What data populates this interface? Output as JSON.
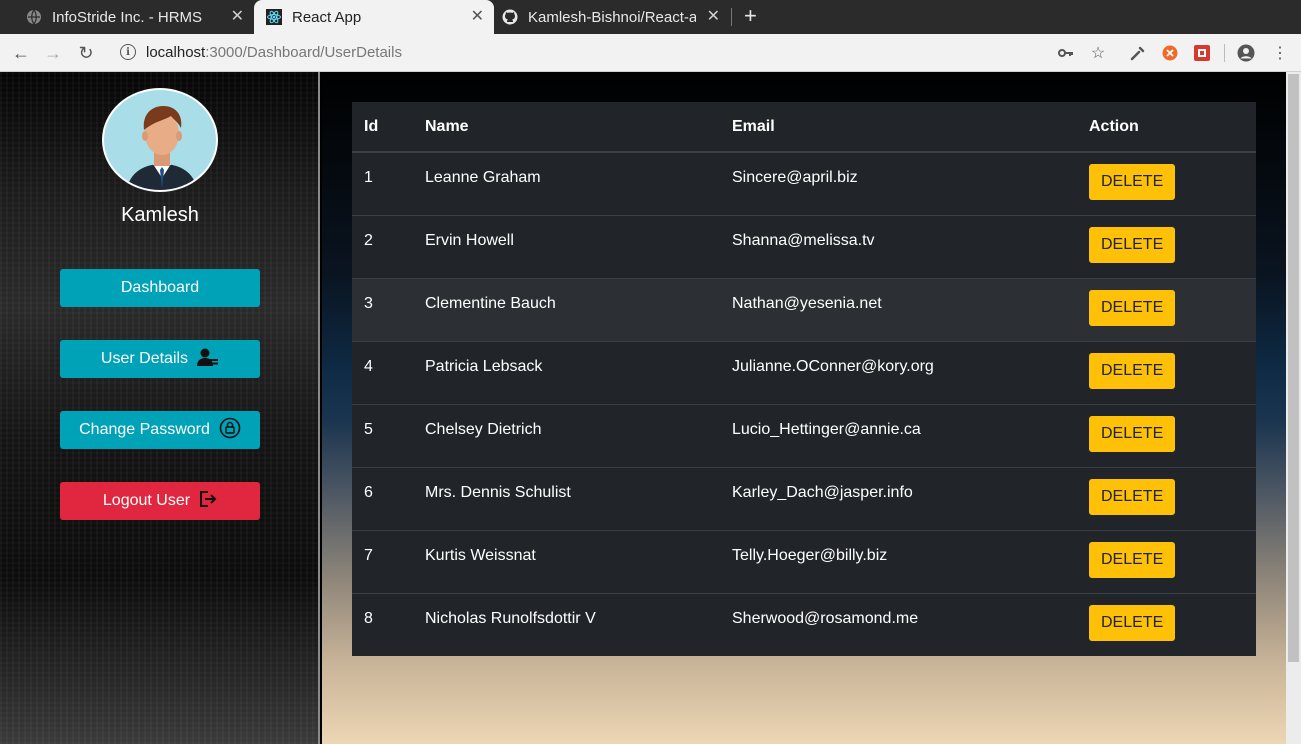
{
  "browser": {
    "tabs": [
      {
        "title": "InfoStride Inc. - HRMS",
        "icon": "globe-icon"
      },
      {
        "title": "React App",
        "icon": "react-icon"
      },
      {
        "title": "Kamlesh-Bishnoi/React-ap",
        "icon": "github-icon"
      }
    ],
    "url_host": "localhost",
    "url_path": ":3000/Dashboard/UserDetails"
  },
  "sidebar": {
    "username": "Kamlesh",
    "buttons": [
      {
        "label": "Dashboard",
        "icon": ""
      },
      {
        "label": "User Details",
        "icon": "user-details-icon"
      },
      {
        "label": "Change Password",
        "icon": "lock-icon"
      },
      {
        "label": "Logout User",
        "icon": "logout-icon"
      }
    ]
  },
  "table": {
    "headers": {
      "id": "Id",
      "name": "Name",
      "email": "Email",
      "action": "Action"
    },
    "delete_label": "DELETE",
    "rows": [
      {
        "id": "1",
        "name": "Leanne Graham",
        "email": "Sincere@april.biz"
      },
      {
        "id": "2",
        "name": "Ervin Howell",
        "email": "Shanna@melissa.tv"
      },
      {
        "id": "3",
        "name": "Clementine Bauch",
        "email": "Nathan@yesenia.net"
      },
      {
        "id": "4",
        "name": "Patricia Lebsack",
        "email": "Julianne.OConner@kory.org"
      },
      {
        "id": "5",
        "name": "Chelsey Dietrich",
        "email": "Lucio_Hettinger@annie.ca"
      },
      {
        "id": "6",
        "name": "Mrs. Dennis Schulist",
        "email": "Karley_Dach@jasper.info"
      },
      {
        "id": "7",
        "name": "Kurtis Weissnat",
        "email": "Telly.Hoeger@billy.biz"
      },
      {
        "id": "8",
        "name": "Nicholas Runolfsdottir V",
        "email": "Sherwood@rosamond.me"
      }
    ]
  },
  "colors": {
    "sidebar_button": "#00a2b8",
    "logout_button": "#e0273f",
    "delete_button": "#ffc107",
    "table_bg": "#212529"
  }
}
